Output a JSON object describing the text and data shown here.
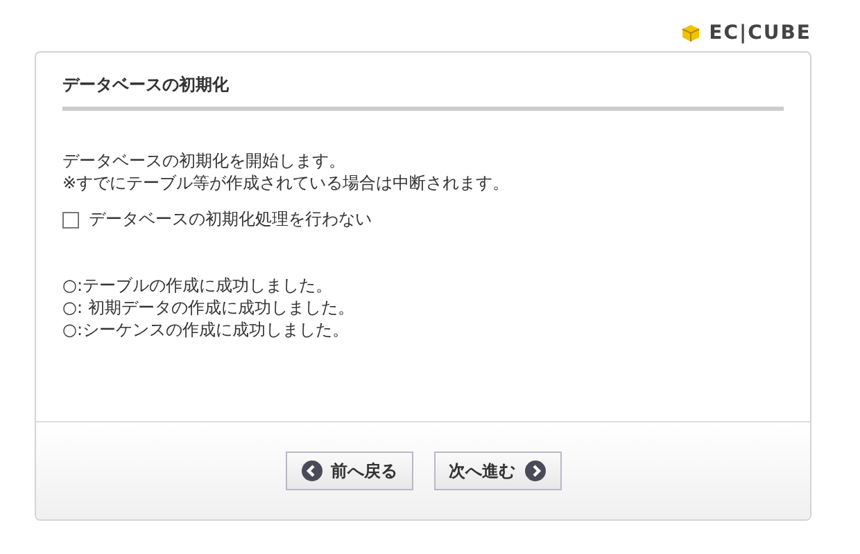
{
  "logo": "EC|CUBE",
  "title": "データベースの初期化",
  "intro": [
    "データベースの初期化を開始します。",
    "※すでにテーブル等が作成されている場合は中断されます。"
  ],
  "skip_option": {
    "label": "データベースの初期化処理を行わない",
    "checked": false
  },
  "results": [
    "○:テーブルの作成に成功しました。",
    "○: 初期データの作成に成功しました。",
    "○:シーケンスの作成に成功しました。"
  ],
  "buttons": [
    {
      "kind": "back",
      "label": "前へ戻る"
    },
    {
      "kind": "next",
      "label": "次へ進む"
    }
  ]
}
